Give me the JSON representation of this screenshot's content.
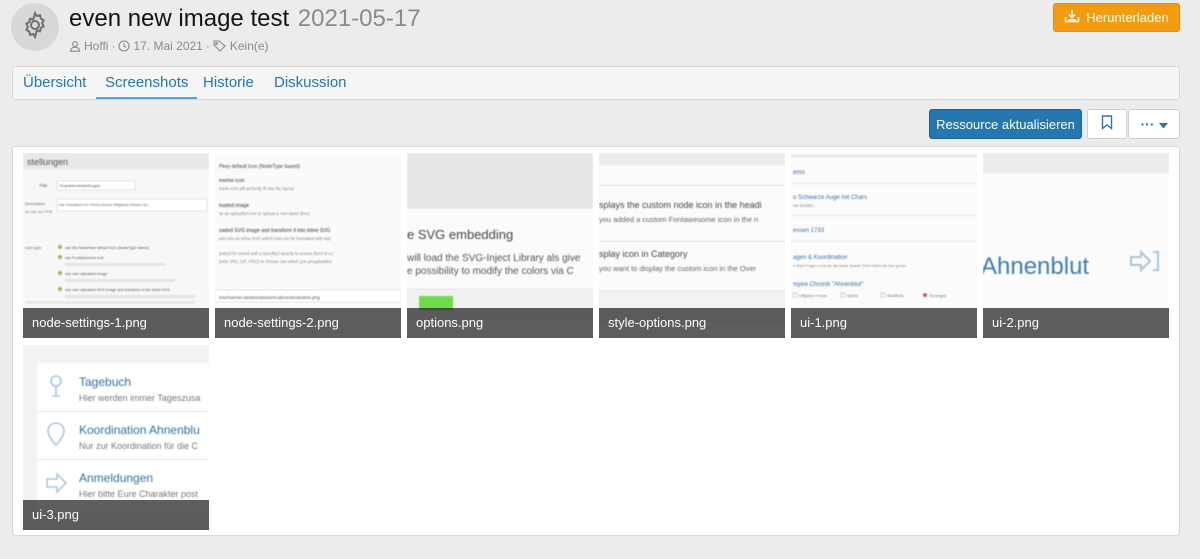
{
  "resource": {
    "title": "even new image test",
    "version": "2021-05-17",
    "author": "Hoffi",
    "date": "17. Mai 2021",
    "tags": "Kein(e)"
  },
  "header": {
    "download_label": "Herunterladen",
    "separator": "·"
  },
  "tabs": [
    {
      "label": "Übersicht",
      "active": false
    },
    {
      "label": "Screenshots",
      "active": true
    },
    {
      "label": "Historie",
      "active": false
    },
    {
      "label": "Diskussion",
      "active": false
    }
  ],
  "toolbar": {
    "update_label": "Ressource aktualisieren",
    "more_label": "···"
  },
  "screenshots": [
    {
      "caption": "node-settings-1.png",
      "preview_lines": [
        "stellungen",
        "Title",
        "Charaktereinstellungen",
        "Description",
        "Die Charaktere im Thema Unsere Mitglieder können sie...",
        "ich wild als HTML",
        "Icon type",
        "use the NodeFlare default icon (NodeType based)",
        "use Fontawesome icon",
        "use own uploaded image",
        "use own uploaded SVG image and transform it into inline SVG"
      ]
    },
    {
      "caption": "node-settings-2.png",
      "preview_lines": [
        "Pkey default Icon (NodeType based)",
        "esome icon",
        "some icon will perfectly fit into the layout.",
        "loaded image",
        "se an uploaded icon or upload a new asset direct.",
        "oaded SVG image and transform it into inline SVG",
        "turn into an inline SVG which now can be formatted with styl",
        "putted for unreal with a specified opacity to ensure there is a c",
        "ports JPG, GIF, PNG) or choose one which you preuploaded",
        "luschwerter.de/dev/assets/ncalicons/industrie.png"
      ]
    },
    {
      "caption": "options.png",
      "preview_lines": [
        "e SVG embedding",
        "will load the SVG-Inject Library als give",
        "e possibility to modify the colors via C"
      ]
    },
    {
      "caption": "style-options.png",
      "preview_lines": [
        "splays the custom node icon in the headi",
        "you added a custom Fontawesome icon in the n",
        "splay icon in Category",
        "you want to display the custom icon in the Over"
      ]
    },
    {
      "caption": "ui-1.png",
      "preview_lines": [
        "emo",
        "o Schwarze Auge mit Chars",
        "um beiden...",
        "essen 1733",
        "agen & Koordination",
        "e Rast Fragen rund um die Neue Spiele! Oben blickt die hier genau",
        "mpire Chronik \"Ahnenblut\"",
        "Offgame Forum",
        "Spiele",
        "Stadtteile",
        "Sonstiges"
      ]
    },
    {
      "caption": "ui-2.png",
      "preview_lines": [
        "Ahnenblut"
      ]
    },
    {
      "caption": "ui-3.png",
      "preview_lines": [
        "Tagebuch",
        "Hier werden immer Tageszusa",
        "Koordination Ahnenblu",
        "Nur zur Koordination für die C",
        "Anmeldungen",
        "Hier bitte Eure Charakter post"
      ]
    }
  ],
  "colors": {
    "accent": "#2577b1",
    "download": "#f39c12",
    "tab_underline": "#47a7eb"
  }
}
